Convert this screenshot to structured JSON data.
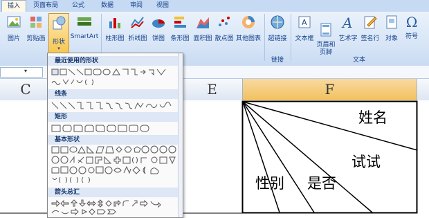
{
  "tabs": [
    "插入",
    "页面布局",
    "公式",
    "数据",
    "审阅",
    "视图"
  ],
  "active_tab": "插入",
  "ribbon": {
    "buttons": [
      {
        "label": "图片",
        "icon": "picture-icon"
      },
      {
        "label": "剪贴画",
        "icon": "clipart-icon"
      },
      {
        "label": "形状",
        "icon": "shapes-icon"
      },
      {
        "label": "SmartArt",
        "icon": "smartart-icon"
      },
      {
        "label": "柱形图",
        "icon": "column-chart-icon"
      },
      {
        "label": "折线图",
        "icon": "line-chart-icon"
      },
      {
        "label": "饼图",
        "icon": "pie-chart-icon"
      },
      {
        "label": "条形图",
        "icon": "bar-chart-icon"
      },
      {
        "label": "面积图",
        "icon": "area-chart-icon"
      },
      {
        "label": "散点图",
        "icon": "scatter-chart-icon"
      },
      {
        "label": "其他图表",
        "icon": "other-chart-icon"
      },
      {
        "label": "超链接",
        "icon": "hyperlink-icon"
      },
      {
        "label": "文本框",
        "icon": "textbox-icon"
      },
      {
        "label": "页眉和\n页脚",
        "icon": "header-footer-icon"
      },
      {
        "label": "艺术字",
        "icon": "wordart-icon"
      },
      {
        "label": "签名行",
        "icon": "signature-icon"
      },
      {
        "label": "对象",
        "icon": "object-icon"
      },
      {
        "label": "符号",
        "icon": "symbol-icon"
      }
    ],
    "groups": {
      "links": "链接",
      "text": "文本"
    }
  },
  "columns": [
    "C",
    "E",
    "F"
  ],
  "cells": {
    "name": "姓名",
    "test": "试试",
    "gender": "性别",
    "yesno": "是否"
  },
  "menu": {
    "sections": [
      "最近使用的形状",
      "线条",
      "矩形",
      "基本形状",
      "箭头总汇"
    ]
  }
}
